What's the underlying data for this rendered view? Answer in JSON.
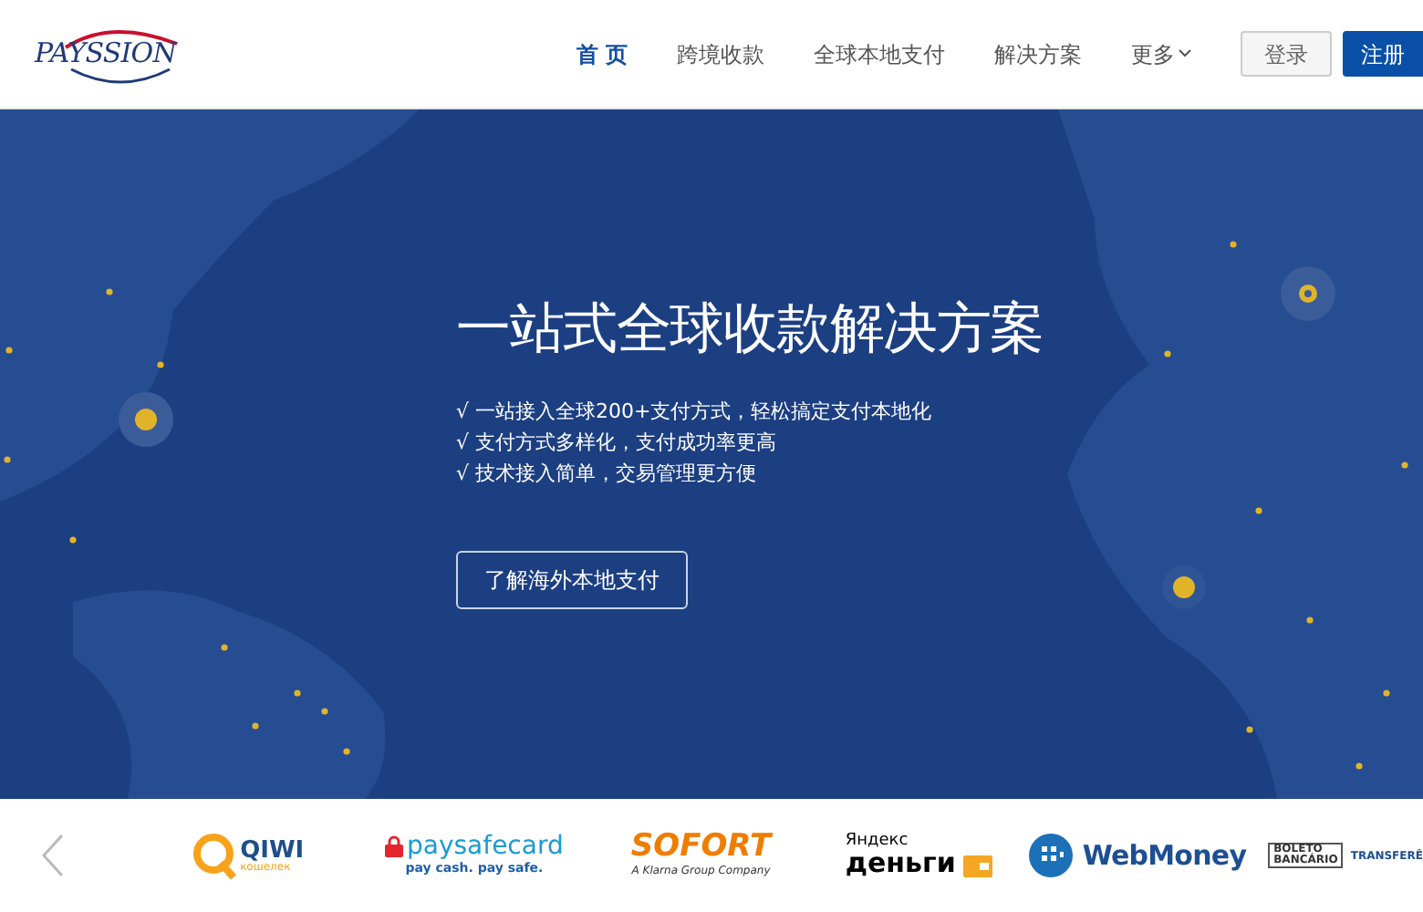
{
  "header": {
    "logo": "PAYSSION",
    "nav": [
      {
        "label": "首 页",
        "selected": true
      },
      {
        "label": "跨境收款",
        "selected": false
      },
      {
        "label": "全球本地支付",
        "selected": false
      },
      {
        "label": "解决方案",
        "selected": false
      },
      {
        "label": "更多",
        "selected": false,
        "dropdown": true
      }
    ],
    "login": "登录",
    "register": "注册"
  },
  "hero": {
    "title": "一站式全球收款解决方案",
    "points": [
      "√ 一站接入全球200+支付方式，轻松搞定支付本地化",
      "√ 支付方式多样化，支付成功率更高",
      "√ 技术接入简单，交易管理更方便"
    ],
    "cta": "了解海外本地支付"
  },
  "partners": [
    {
      "kind": "qiwi",
      "name": "QIWI",
      "sub": "кошелек"
    },
    {
      "kind": "paysafe",
      "name": "paysafecard",
      "sub": "pay cash. pay safe."
    },
    {
      "kind": "sofort",
      "name": "SOFORT",
      "sub": "A Klarna Group Company"
    },
    {
      "kind": "yandex",
      "name": "Яндекс",
      "sub": "деньги"
    },
    {
      "kind": "webmoney",
      "name": "WebMoney"
    },
    {
      "kind": "boleto",
      "name": "BOLETO",
      "sub": "BANCÁRIO",
      "extra": "TRANSFERÊ"
    }
  ]
}
